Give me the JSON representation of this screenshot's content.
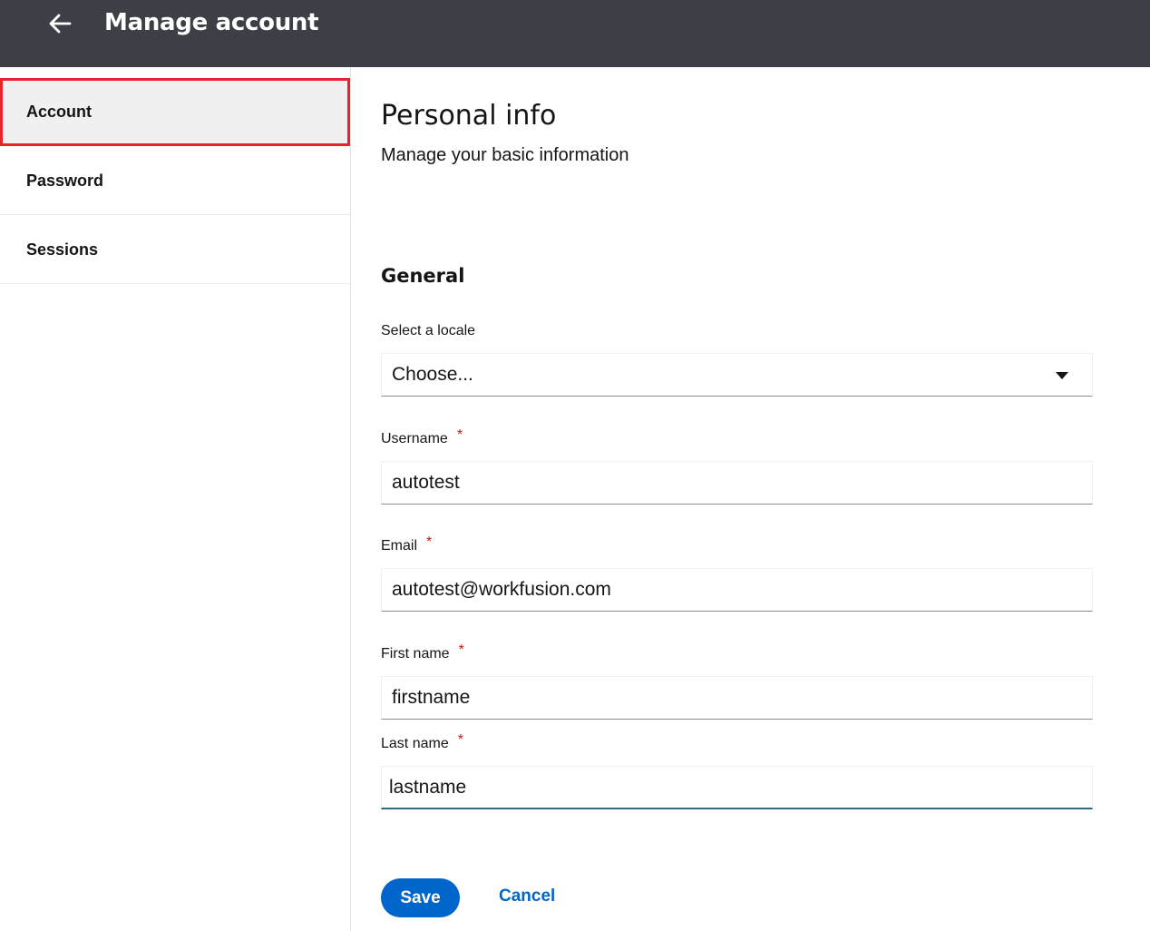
{
  "header": {
    "title": "Manage account",
    "back_icon": "arrow-left-icon"
  },
  "sidebar": {
    "items": [
      {
        "label": "Account",
        "active": true
      },
      {
        "label": "Password",
        "active": false
      },
      {
        "label": "Sessions",
        "active": false
      }
    ]
  },
  "main": {
    "title": "Personal info",
    "subtitle": "Manage your basic information",
    "section_title": "General",
    "fields": {
      "locale": {
        "label": "Select a locale",
        "value": "Choose...",
        "required": false
      },
      "username": {
        "label": "Username",
        "value": "autotest",
        "required": true
      },
      "email": {
        "label": "Email",
        "value": "autotest@workfusion.com",
        "required": true
      },
      "first_name": {
        "label": "First name",
        "value": "firstname",
        "required": true
      },
      "last_name": {
        "label": "Last name",
        "value": "lastname",
        "required": true
      }
    },
    "required_marker": "*",
    "save_label": "Save",
    "cancel_label": "Cancel"
  },
  "colors": {
    "header_bg": "#3c3f46",
    "primary": "#0066cc",
    "required": "#c9190b",
    "active_outline": "#e8232a"
  }
}
